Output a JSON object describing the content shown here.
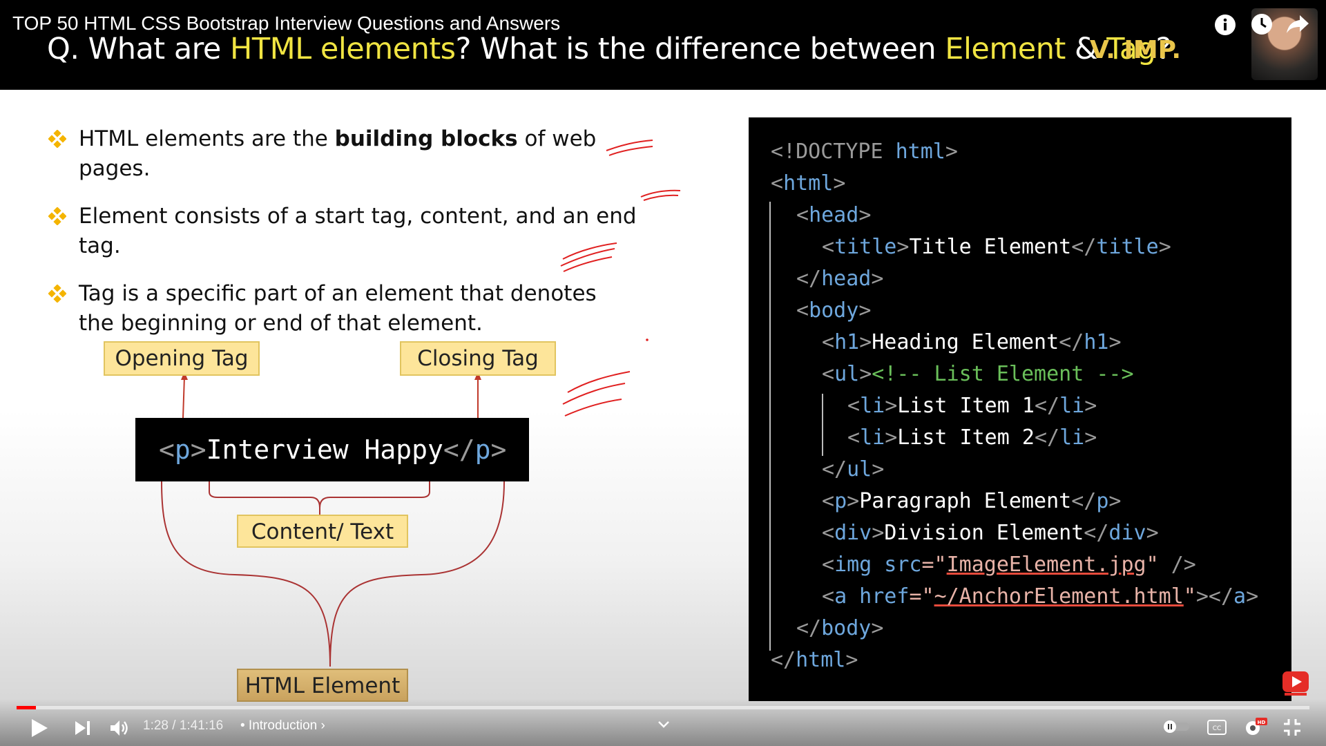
{
  "video": {
    "title": "TOP 50 HTML CSS Bootstrap Interview Questions and Answers"
  },
  "question": {
    "prefix": "Q. What are ",
    "highlight1": "HTML elements",
    "mid": "? What is the difference between ",
    "highlight2": "Element",
    "amp": " & ",
    "highlight3": "Tag",
    "suffix": "?",
    "badge": "V. IMP."
  },
  "bullets": [
    {
      "pre": "HTML elements are the ",
      "bold": "building blocks",
      "post": " of web pages."
    },
    {
      "pre": "Element consists of a start tag, content, and an end tag.",
      "bold": "",
      "post": ""
    },
    {
      "pre": "Tag is a specific part of an element that denotes the beginning or end of that element.",
      "bold": "",
      "post": ""
    }
  ],
  "diagram": {
    "opening_label": "Opening Tag",
    "closing_label": "Closing Tag",
    "content_label": "Content/ Text",
    "element_label": "HTML Element",
    "code_open_lt": "<",
    "code_open_tag": "p",
    "code_open_gt": ">",
    "code_text": "Interview Happy",
    "code_close_lt": "</",
    "code_close_tag": "p",
    "code_close_gt": ">"
  },
  "code": {
    "l1a": "<!DOCTYPE",
    "l1b": " html",
    "l1c": ">",
    "l2a": "<",
    "l2b": "html",
    "l2c": ">",
    "l3a": "<",
    "l3b": "head",
    "l3c": ">",
    "l4a": "<",
    "l4b": "title",
    "l4c": ">",
    "l4d": "Title Element",
    "l4e": "</",
    "l4f": "title",
    "l4g": ">",
    "l5a": "</",
    "l5b": "head",
    "l5c": ">",
    "l6a": "<",
    "l6b": "body",
    "l6c": ">",
    "l7a": "<",
    "l7b": "h1",
    "l7c": ">",
    "l7d": "Heading Element",
    "l7e": "</",
    "l7f": "h1",
    "l7g": ">",
    "l8a": "<",
    "l8b": "ul",
    "l8c": ">",
    "l8d": "<!-- List Element -->",
    "l9a": "<",
    "l9b": "li",
    "l9c": ">",
    "l9d": "List Item 1",
    "l9e": "</",
    "l9f": "li",
    "l9g": ">",
    "l10a": "<",
    "l10b": "li",
    "l10c": ">",
    "l10d": "List Item 2",
    "l10e": "</",
    "l10f": "li",
    "l10g": ">",
    "l11a": "</",
    "l11b": "ul",
    "l11c": ">",
    "l12a": "<",
    "l12b": "p",
    "l12c": ">",
    "l12d": "Paragraph Element",
    "l12e": "</",
    "l12f": "p",
    "l12g": ">",
    "l13a": "<",
    "l13b": "div",
    "l13c": ">",
    "l13d": "Division Element",
    "l13e": "</",
    "l13f": "div",
    "l13g": ">",
    "l14a": "<",
    "l14b": "img",
    "l14c": " src",
    "l14d": "=\"",
    "l14e": "ImageElement.jpg",
    "l14f": "\"",
    "l14g": " />",
    "l15a": "<",
    "l15b": "a",
    "l15c": " href",
    "l15d": "=\"",
    "l15e": "~/AnchorElement.html",
    "l15f": "\"",
    "l15g": "></",
    "l15h": "a",
    "l15i": ">",
    "l16a": "</",
    "l16b": "body",
    "l16c": ">",
    "l17a": "</",
    "l17b": "html",
    "l17c": ">"
  },
  "player": {
    "time": "1:28 / 1:41:16",
    "chapter": "• Introduction ›",
    "progress": 0.015,
    "accent": "#ff0000",
    "icons": [
      "info-icon",
      "watch-later-icon",
      "share-icon",
      "play-icon",
      "next-icon",
      "volume-icon",
      "autoplay-icon",
      "captions-icon",
      "settings-icon",
      "fullscreen-exit-icon",
      "chevron-down-icon",
      "subscribe-icon"
    ]
  },
  "colors": {
    "highlight": "#f0e442",
    "badge": "#e9c54a",
    "tag": "#6ea7dd",
    "comment": "#6abf5a",
    "bullet": "#f4b400",
    "annotation": "#e02020"
  }
}
